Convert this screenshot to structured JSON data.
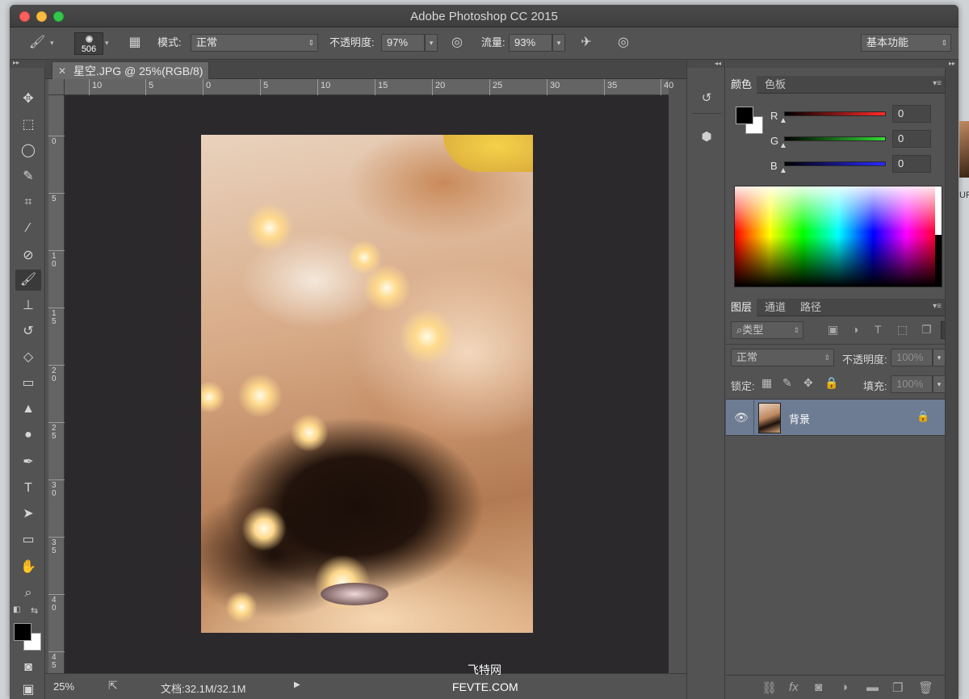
{
  "app": {
    "title": "Adobe Photoshop CC 2015"
  },
  "options": {
    "brush_size": "506",
    "mode_label": "模式:",
    "mode_value": "正常",
    "opacity_label": "不透明度:",
    "opacity_value": "97%",
    "flow_label": "流量:",
    "flow_value": "93%",
    "workspace": "基本功能"
  },
  "document": {
    "tab_label": "星空.JPG @ 25%(RGB/8)",
    "zoom": "25%",
    "doc_info": "文档:32.1M/32.1M"
  },
  "rulers": {
    "h_ticks": [
      "10",
      "5",
      "0",
      "5",
      "10",
      "15",
      "20",
      "25",
      "30",
      "35",
      "40"
    ],
    "v_ticks": [
      "0",
      "5",
      "10",
      "15",
      "20",
      "25",
      "30",
      "35",
      "40",
      "45"
    ]
  },
  "color_panel": {
    "tabs": [
      "颜色",
      "色板"
    ],
    "channels": [
      {
        "label": "R",
        "value": "0",
        "color": "#ff2a2a"
      },
      {
        "label": "G",
        "value": "0",
        "color": "#33dd33"
      },
      {
        "label": "B",
        "value": "0",
        "color": "#2a2aff"
      }
    ],
    "foreground": "#000000",
    "background": "#ffffff"
  },
  "layers_panel": {
    "tabs": [
      "图层",
      "通道",
      "路径"
    ],
    "filter_kind": "类型",
    "blend_mode": "正常",
    "opacity_label": "不透明度:",
    "opacity_value": "100%",
    "lock_label": "锁定:",
    "fill_label": "填充:",
    "fill_value": "100%",
    "layers": [
      {
        "name": "背景",
        "visible": true,
        "locked": true
      }
    ]
  },
  "watermark": {
    "line1": "飞特网",
    "line2": "FEVTE.COM"
  },
  "edge_text": "UP",
  "colors": {
    "selection": "#6d7b93",
    "panel": "#535353"
  }
}
